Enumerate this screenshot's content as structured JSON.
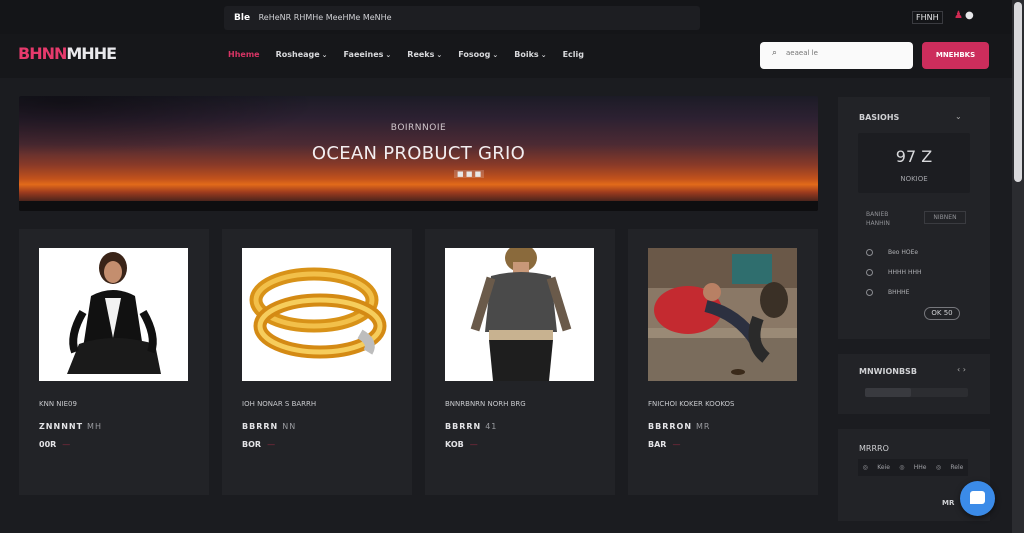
{
  "announcement": {
    "tag": "Ble",
    "text": "ReHeNR RHMHe MeeHMe MeNHe"
  },
  "top_utilities": {
    "lang": "FHNH",
    "icons": [
      "user-icon",
      "globe-icon"
    ]
  },
  "header": {
    "logo": {
      "part1": "BHNN",
      "part2": "MHHE"
    },
    "nav": [
      {
        "label": "Hheme",
        "active": true,
        "has_dropdown": false
      },
      {
        "label": "Rosheage",
        "active": false,
        "has_dropdown": true
      },
      {
        "label": "Faeeines",
        "active": false,
        "has_dropdown": true
      },
      {
        "label": "Reeks",
        "active": false,
        "has_dropdown": true
      },
      {
        "label": "Fosoog",
        "active": false,
        "has_dropdown": true
      },
      {
        "label": "Boiks",
        "active": false,
        "has_dropdown": true
      },
      {
        "label": "Eclig",
        "active": false,
        "has_dropdown": false
      }
    ],
    "search_placeholder": "aeaeal le",
    "cta_label": "MNEHBKS"
  },
  "hero": {
    "kicker": "BOIRNNOIE",
    "title": "OCEAN PROBUCT GRIO",
    "dots": "■ ■ ■"
  },
  "products": [
    {
      "name": "KNN NIE09",
      "meta": "ZNNNNT",
      "meta_sub": "MH",
      "price": "00R",
      "price_sub": "—"
    },
    {
      "name": "IOH NONAR S BARRH",
      "meta": "BBRRN",
      "meta_sub": "NN",
      "price": "BOR",
      "price_sub": "—"
    },
    {
      "name": "BNNRBNRN NORH BRG",
      "meta": "BBRRN",
      "meta_sub": "41",
      "price": "KOB",
      "price_sub": "—"
    },
    {
      "name": "FNICHOI KOKER KOOKOS",
      "meta": "BBRRON",
      "meta_sub": "MR",
      "price": "BAR",
      "price_sub": "—"
    }
  ],
  "sidebar": {
    "panel1": {
      "header": "BASIOHS",
      "stat_value": "97 Z",
      "stat_label": "NOKIOE",
      "row_text": "BANIEB\nHANHIN",
      "small_btn": "NIBNEN",
      "list": [
        "Beo HOEe",
        "HHHH HHH",
        "BHHHE"
      ],
      "pill": "OK  50"
    },
    "panel2": {
      "header": "MNWIONBSB",
      "ctrl": "‹ ›",
      "progress": 0.45
    },
    "panel3": {
      "header": "MRRRO",
      "chips": [
        "Keie",
        "HHe",
        "Rele"
      ],
      "more": "MR"
    }
  },
  "colors": {
    "accent": "#cc2d5c",
    "chat": "#3b8be8",
    "background": "#1b1c20"
  }
}
